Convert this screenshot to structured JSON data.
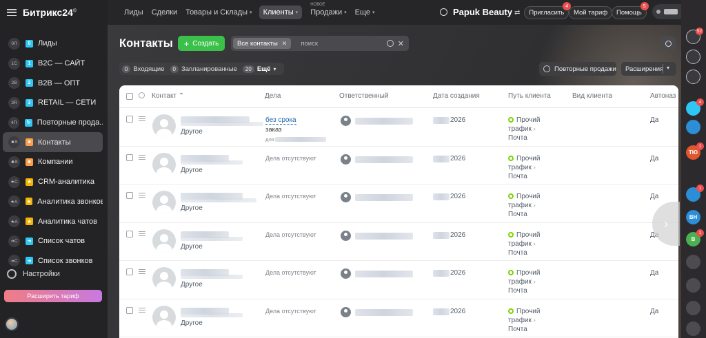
{
  "app": {
    "logo": "Битрикс24",
    "logo_sup": "©"
  },
  "topnav": {
    "items": [
      {
        "label": "Лиды"
      },
      {
        "label": "Сделки"
      },
      {
        "label": "Товары и Склады"
      },
      {
        "label": "Клиенты"
      },
      {
        "label": "Продажи",
        "new": "НОВОЕ"
      },
      {
        "label": "Еще"
      }
    ],
    "company": "Papuk Beauty",
    "invite": "Пригласить",
    "invite_badge": "4",
    "my_plan": "Мой тариф",
    "help": "Помощь",
    "help_badge": "5"
  },
  "sidebar": {
    "items": [
      {
        "counter": "0Л",
        "icon": "0",
        "icon_color": "#2fc6f6",
        "label": "Лиды"
      },
      {
        "counter": "1С",
        "icon": "1",
        "icon_color": "#2fc6f6",
        "label": "B2C — САЙТ"
      },
      {
        "counter": "2В",
        "icon": "2",
        "icon_color": "#2fc6f6",
        "label": "B2B — ОПТ"
      },
      {
        "counter": "3R",
        "icon": "3",
        "icon_color": "#2fc6f6",
        "label": "RETAIL — СЕТИ"
      },
      {
        "counter": "4П",
        "icon": "↻",
        "icon_color": "#2fc6f6",
        "label": "Повторные прода..."
      },
      {
        "counter": "☻К",
        "icon": "☻",
        "icon_color": "#ff9f45",
        "label": "Контакты"
      },
      {
        "counter": "☻К",
        "icon": "☻",
        "icon_color": "#ff9f45",
        "label": "Компании"
      },
      {
        "counter": "★С",
        "icon": "★",
        "icon_color": "#f5b400",
        "label": "CRM-аналитика"
      },
      {
        "counter": "★А",
        "icon": "★",
        "icon_color": "#f5b400",
        "label": "Аналитика звонков"
      },
      {
        "counter": "★А",
        "icon": "★",
        "icon_color": "#f5b400",
        "label": "Аналитика чатов"
      },
      {
        "counter": "➜С",
        "icon": "➜",
        "icon_color": "#2fc6f6",
        "label": "Список чатов"
      },
      {
        "counter": "➜С",
        "icon": "➜",
        "icon_color": "#2fc6f6",
        "label": "Список звонков"
      }
    ],
    "settings": "Настройки",
    "upgrade": "Расширить тариф"
  },
  "page": {
    "title": "Контакты",
    "create": "Создать",
    "filter_tag": "Все контакты",
    "search_placeholder": "поиск",
    "counters": [
      {
        "num": "0",
        "label": "Входящие"
      },
      {
        "num": "0",
        "label": "Запланированные"
      },
      {
        "num": "20",
        "label": "Ещё"
      }
    ],
    "repeat_sales": "Повторные продажи",
    "extensions": "Расширения"
  },
  "table": {
    "headers": {
      "contact": "Контакт ⌃",
      "deals": "Дела",
      "responsible": "Ответственный",
      "created": "Дата создания",
      "path": "Путь клиента",
      "type": "Вид клиента",
      "auto": "Автоназ"
    },
    "rows": [
      {
        "type": "Другое",
        "deal_link": "без срока",
        "deal_order": "заказ",
        "deal_for": "для",
        "date": "2026",
        "path1": "Прочий",
        "path2": "трафик",
        "path3": "Почта",
        "auto": "Да"
      },
      {
        "type": "Другое",
        "deal_none": "Дела отсутствуют",
        "date": "2026",
        "path1": "Прочий",
        "path2": "трафик",
        "path3": "Почта",
        "auto": "Да"
      },
      {
        "type": "Другое",
        "deal_none": "Дела отсутствуют",
        "date": "2026",
        "path1": "Прочий",
        "path2": "трафик",
        "path3": "Почта",
        "auto": "Да"
      },
      {
        "type": "Другое",
        "deal_none": "Дела отсутствуют",
        "date": "2026",
        "path1": "Прочий",
        "path2": "трафик",
        "path3": "Почта",
        "auto": "Да"
      },
      {
        "type": "Другое",
        "deal_none": "Дела отсутствуют",
        "date": "2026",
        "path1": "Прочий",
        "path2": "трафик",
        "path3": "Почта",
        "auto": "Да"
      },
      {
        "type": "Другое",
        "deal_none": "Дела отсутствуют",
        "date": "2026",
        "path1": "Прочий",
        "path2": "трафик",
        "path3": "Почта",
        "auto": "Да"
      }
    ]
  },
  "rail": {
    "items": [
      {
        "label": "",
        "color": "#3a3a3e",
        "badge": "52",
        "icon": "bell-icon"
      },
      {
        "label": "",
        "color": "#3a3a3e",
        "badge": "",
        "icon": "openlines-icon"
      },
      {
        "label": "",
        "color": "#3a3a3e",
        "badge": "",
        "icon": "chat-icon"
      },
      {
        "label": "",
        "color": "#2fc6f6",
        "badge": "4",
        "icon": "group-chat-icon"
      },
      {
        "label": "",
        "color": "#2b8ed6",
        "badge": "",
        "icon": "user-avatar-icon"
      },
      {
        "label": "ТЮ",
        "color": "#e2562e",
        "badge": "1",
        "icon": ""
      },
      {
        "label": "",
        "color": "#2b8ed6",
        "badge": "1",
        "icon": "user-avatar-icon"
      },
      {
        "label": "ВН",
        "color": "#2b8ed6",
        "badge": "",
        "icon": ""
      },
      {
        "label": "В",
        "color": "#4caf50",
        "badge": "1",
        "icon": ""
      }
    ]
  }
}
